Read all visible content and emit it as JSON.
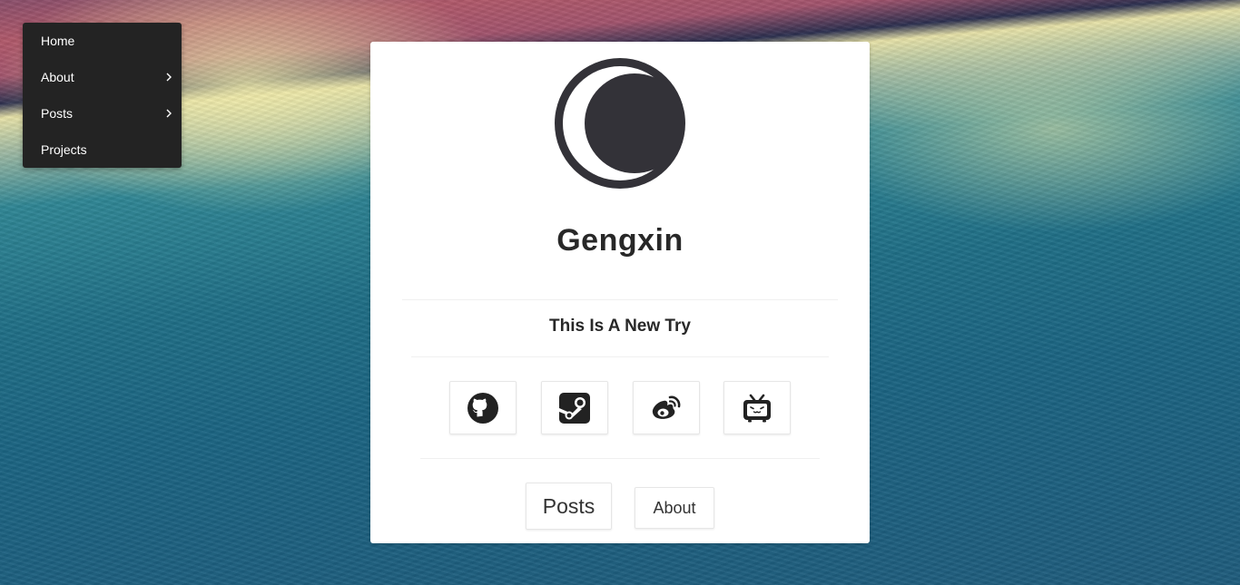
{
  "menu": {
    "items": [
      {
        "label": "Home",
        "has_submenu": false
      },
      {
        "label": "About",
        "has_submenu": true
      },
      {
        "label": "Posts",
        "has_submenu": true
      },
      {
        "label": "Projects",
        "has_submenu": false
      }
    ]
  },
  "profile": {
    "avatar_icon": "moon-icon",
    "name": "Gengxin",
    "tagline": "This Is A New Try"
  },
  "social_links": [
    {
      "icon": "github-icon"
    },
    {
      "icon": "steam-icon"
    },
    {
      "icon": "weibo-icon"
    },
    {
      "icon": "bilibili-icon"
    }
  ],
  "buttons": {
    "posts_label": "Posts",
    "about_label": "About"
  },
  "colors": {
    "menu_bg": "#232323",
    "icon_dark": "#333238",
    "card_bg": "#ffffff"
  }
}
